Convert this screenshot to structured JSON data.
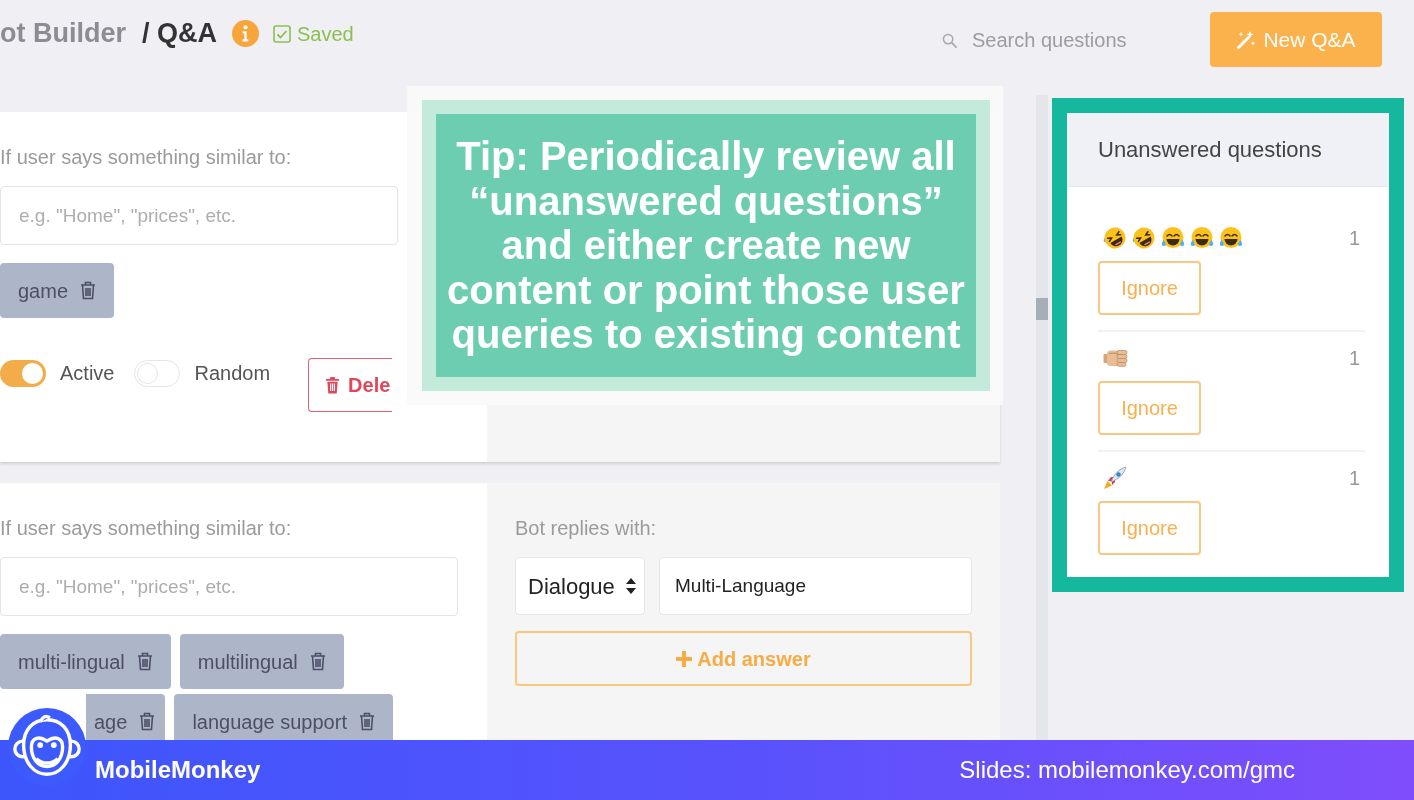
{
  "header": {
    "title": "ot Builder",
    "section": "/ Q&A",
    "save_status": "Saved",
    "search": {
      "placeholder": "Search questions"
    },
    "new_button": "New Q&A"
  },
  "qa_cards": [
    {
      "trigger_label": "If user says something similar to:",
      "trigger_input": {
        "placeholder": "e.g. \"Home\", \"prices\", etc."
      },
      "tags": [
        {
          "text": "game",
          "kind": "whole"
        }
      ],
      "toggles": [
        {
          "label": "Active",
          "on": true
        },
        {
          "label": "Random",
          "on": false
        }
      ],
      "delete_button": "Dele"
    },
    {
      "trigger_label": "If user says something similar to:",
      "trigger_input": {
        "placeholder": "e.g. \"Home\", \"prices\", etc."
      },
      "tags": [
        {
          "text": "multi-lingual",
          "kind": "whole"
        },
        {
          "text": "multilingual",
          "kind": "whole"
        },
        {
          "text": "age",
          "kind": "clipped"
        },
        {
          "text": "language support",
          "kind": "whole"
        }
      ],
      "reply": {
        "label": "Bot replies with:",
        "type_select": "Dialogue",
        "value": "Multi-Language",
        "add_button": "Add answer"
      }
    }
  ],
  "tip": "Tip: Periodically review all “unanswered questions” and either create new content or point those user queries to existing content",
  "unanswered_panel": {
    "title": "Unanswered questions",
    "items": [
      {
        "emojis": [
          {
            "kind": "rofl"
          },
          {
            "kind": "rofl"
          },
          {
            "kind": "joy"
          },
          {
            "kind": "joy"
          },
          {
            "kind": "joy"
          }
        ],
        "count": "1",
        "button": "Ignore"
      },
      {
        "emojis": [
          {
            "kind": "fist"
          }
        ],
        "count": "1",
        "button": "Ignore"
      },
      {
        "emojis": [
          {
            "kind": "rocket"
          }
        ],
        "count": "1",
        "button": "Ignore"
      }
    ]
  },
  "footer_banner": {
    "brand": "MobileMonkey",
    "slides_link": "Slides: mobilemonkey.com/gmc"
  }
}
